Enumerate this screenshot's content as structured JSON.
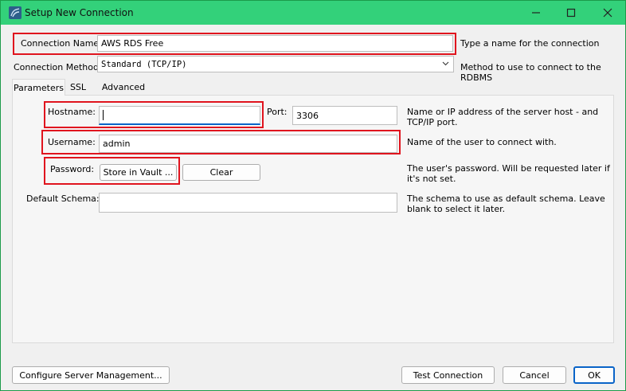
{
  "window": {
    "title": "Setup New Connection"
  },
  "connection_name": {
    "label": "Connection Name:",
    "value": "AWS RDS Free",
    "hint": "Type a name for the connection"
  },
  "connection_method": {
    "label": "Connection Method:",
    "value": "Standard (TCP/IP)",
    "hint": "Method to use to connect to the RDBMS"
  },
  "tabs": [
    {
      "label": "Parameters",
      "active": true
    },
    {
      "label": "SSL",
      "active": false
    },
    {
      "label": "Advanced",
      "active": false
    }
  ],
  "hostname": {
    "label": "Hostname:",
    "value": "",
    "hint": "Name or IP address of the server host - and TCP/IP port."
  },
  "port": {
    "label": "Port:",
    "value": "3306"
  },
  "username": {
    "label": "Username:",
    "value": "admin",
    "hint": "Name of the user to connect with."
  },
  "password": {
    "label": "Password:",
    "store_button": "Store in Vault ...",
    "clear_button": "Clear",
    "hint": "The user's password. Will be requested later if it's not set."
  },
  "default_schema": {
    "label": "Default Schema:",
    "value": "",
    "hint": "The schema to use as default schema. Leave blank to select it later."
  },
  "footer": {
    "configure_button": "Configure Server Management...",
    "test_button": "Test Connection",
    "cancel_button": "Cancel",
    "ok_button": "OK"
  },
  "colors": {
    "titlebar": "#33d17a",
    "highlight": "#e0141e",
    "focus": "#0a64c8"
  },
  "icons": {
    "app": "mysql-workbench-icon",
    "minimize": "minimize-icon",
    "maximize": "maximize-icon",
    "close": "close-icon",
    "dropdown": "chevron-down-icon"
  }
}
